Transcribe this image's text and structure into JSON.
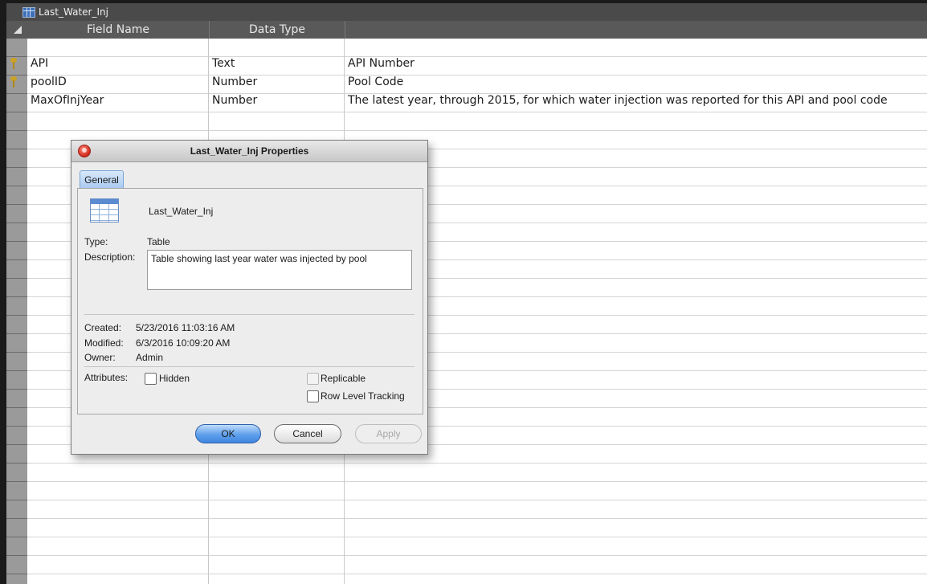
{
  "window": {
    "title": "Last_Water_Inj",
    "icon": "table-icon"
  },
  "header": {
    "field_name": "Field Name",
    "data_type": "Data Type",
    "description": ""
  },
  "rows": [
    {
      "key": true,
      "field": "API",
      "type": "Text",
      "desc": "API Number"
    },
    {
      "key": true,
      "field": "poolID",
      "type": "Number",
      "desc": "Pool Code"
    },
    {
      "key": false,
      "field": "MaxOfInjYear",
      "type": "Number",
      "desc": "The latest year, through 2015, for which water injection was reported for this API and pool code"
    }
  ],
  "dialog": {
    "title": "Last_Water_Inj Properties",
    "tab": "General",
    "object_name": "Last_Water_Inj",
    "type_label": "Type:",
    "type_value": "Table",
    "description_label": "Description:",
    "description_value": "Table showing last year water was injected by pool",
    "created_label": "Created:",
    "created_value": "5/23/2016 11:03:16 AM",
    "modified_label": "Modified:",
    "modified_value": "6/3/2016 10:09:20 AM",
    "owner_label": "Owner:",
    "owner_value": "Admin",
    "attributes_label": "Attributes:",
    "hidden_label": "Hidden",
    "replicable_label": "Replicable",
    "row_level_tracking_label": "Row Level Tracking",
    "ok_label": "OK",
    "cancel_label": "Cancel",
    "apply_label": "Apply"
  }
}
